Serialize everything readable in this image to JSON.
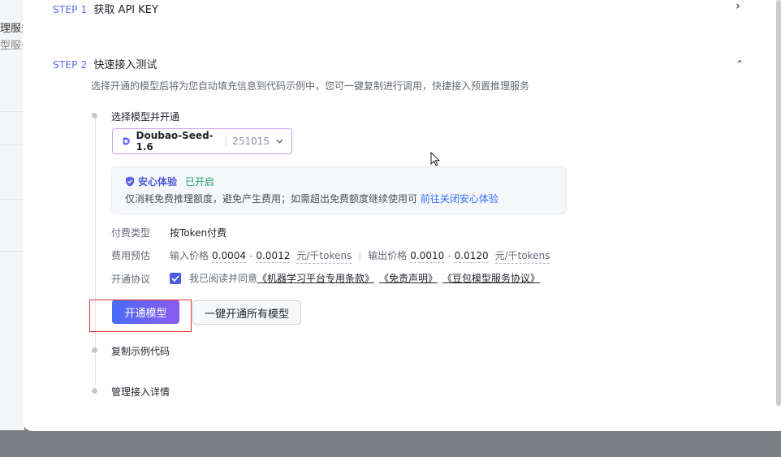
{
  "background": {
    "partial_text_1": "理服务",
    "partial_text_2": "型服务"
  },
  "step1": {
    "tag": "STEP 1",
    "title": "获取 API KEY",
    "chevron": "›"
  },
  "step2": {
    "tag": "STEP 2",
    "title": "快速接入测试",
    "chevron": "⌃",
    "description": "选择开通的模型后将为您自动填充信息到代码示例中，您可一键复制进行调用，快捷接入预置推理服务"
  },
  "timeline": {
    "select_model_title": "选择模型并开通",
    "copy_code_title": "复制示例代码",
    "manage_title": "管理接入详情"
  },
  "model_select": {
    "name": "Doubao-Seed-1.6",
    "version": "251015"
  },
  "safe_experience": {
    "title": "安心体验",
    "status": "已开启",
    "text": "仅消耗免费推理额度，避免产生费用；如需超出免费额度继续使用可",
    "link": "前往关闭安心体验"
  },
  "billing": {
    "type_label": "付费类型",
    "type_value": "按Token付费",
    "estimate_label": "费用预估",
    "input_label": "输入价格",
    "input_min": "0.0004",
    "input_max": "0.0012",
    "input_unit": "元/千tokens",
    "output_label": "输出价格",
    "output_min": "0.0010",
    "output_max": "0.0120",
    "output_unit": "元/千tokens"
  },
  "agreement": {
    "label": "开通协议",
    "prefix": "我已阅读并同意",
    "link1": "《机器学习平台专用条款》",
    "link2": "《免责声明》",
    "link3": "《豆包模型服务协议》"
  },
  "buttons": {
    "activate": "开通模型",
    "activate_all": "一键开通所有模型"
  },
  "colors": {
    "accent": "#4e5bdb",
    "step_tag": "#5b6bf0",
    "success": "#1aa36b",
    "link": "#3370ff",
    "highlight": "#e0302b"
  }
}
